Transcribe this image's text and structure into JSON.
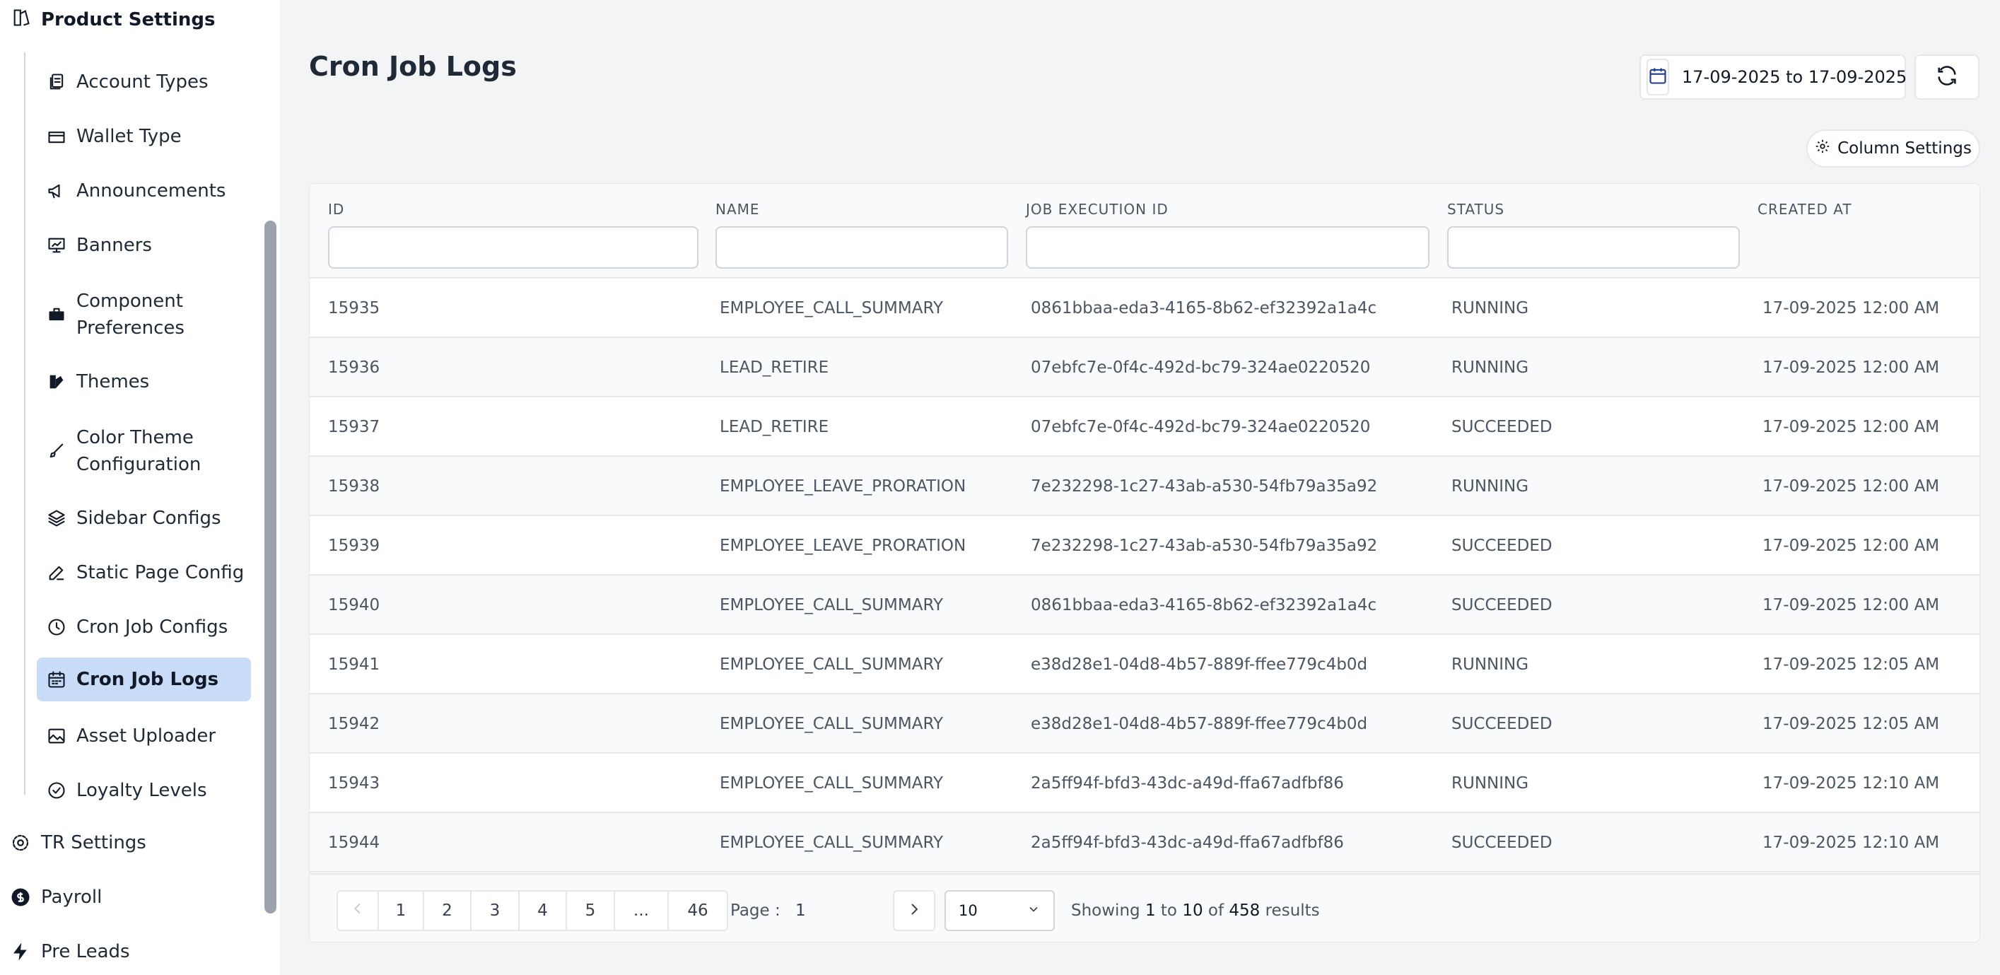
{
  "sidebar": {
    "section_title": "Product Settings",
    "items": [
      {
        "label": "Account Types",
        "icon": "document-copy-icon"
      },
      {
        "label": "Wallet Type",
        "icon": "wallet-icon"
      },
      {
        "label": "Announcements",
        "icon": "megaphone-icon"
      },
      {
        "label": "Banners",
        "icon": "presentation-chart-icon"
      },
      {
        "label": "Component Preferences",
        "icon": "briefcase-icon"
      },
      {
        "label": "Themes",
        "icon": "swatch-icon"
      },
      {
        "label": "Color Theme Configuration",
        "icon": "paintbrush-icon"
      },
      {
        "label": "Sidebar Configs",
        "icon": "layers-icon"
      },
      {
        "label": "Static Page Config",
        "icon": "edit-icon"
      },
      {
        "label": "Cron Job Configs",
        "icon": "clock-icon"
      },
      {
        "label": "Cron Job Logs",
        "icon": "calendar-log-icon",
        "active": true
      },
      {
        "label": "Asset Uploader",
        "icon": "image-icon"
      },
      {
        "label": "Loyalty Levels",
        "icon": "check-circle-icon"
      }
    ],
    "top_items": [
      {
        "label": "TR Settings",
        "icon": "gear-icon"
      },
      {
        "label": "Payroll",
        "icon": "dollar-circle-icon"
      },
      {
        "label": "Pre Leads",
        "icon": "lightning-icon"
      }
    ]
  },
  "header": {
    "title": "Cron Job Logs",
    "date_range": "17-09-2025 to 17-09-2025",
    "column_settings_label": "Column Settings"
  },
  "table": {
    "columns": [
      "ID",
      "NAME",
      "JOB EXECUTION ID",
      "STATUS",
      "CREATED AT"
    ],
    "rows": [
      [
        "15935",
        "EMPLOYEE_CALL_SUMMARY",
        "0861bbaa-eda3-4165-8b62-ef32392a1a4c",
        "RUNNING",
        "17-09-2025 12:00 AM"
      ],
      [
        "15936",
        "LEAD_RETIRE",
        "07ebfc7e-0f4c-492d-bc79-324ae0220520",
        "RUNNING",
        "17-09-2025 12:00 AM"
      ],
      [
        "15937",
        "LEAD_RETIRE",
        "07ebfc7e-0f4c-492d-bc79-324ae0220520",
        "SUCCEEDED",
        "17-09-2025 12:00 AM"
      ],
      [
        "15938",
        "EMPLOYEE_LEAVE_PRORATION",
        "7e232298-1c27-43ab-a530-54fb79a35a92",
        "RUNNING",
        "17-09-2025 12:00 AM"
      ],
      [
        "15939",
        "EMPLOYEE_LEAVE_PRORATION",
        "7e232298-1c27-43ab-a530-54fb79a35a92",
        "SUCCEEDED",
        "17-09-2025 12:00 AM"
      ],
      [
        "15940",
        "EMPLOYEE_CALL_SUMMARY",
        "0861bbaa-eda3-4165-8b62-ef32392a1a4c",
        "SUCCEEDED",
        "17-09-2025 12:00 AM"
      ],
      [
        "15941",
        "EMPLOYEE_CALL_SUMMARY",
        "e38d28e1-04d8-4b57-889f-ffee779c4b0d",
        "RUNNING",
        "17-09-2025 12:05 AM"
      ],
      [
        "15942",
        "EMPLOYEE_CALL_SUMMARY",
        "e38d28e1-04d8-4b57-889f-ffee779c4b0d",
        "SUCCEEDED",
        "17-09-2025 12:05 AM"
      ],
      [
        "15943",
        "EMPLOYEE_CALL_SUMMARY",
        "2a5ff94f-bfd3-43dc-a49d-ffa67adfbf86",
        "RUNNING",
        "17-09-2025 12:10 AM"
      ],
      [
        "15944",
        "EMPLOYEE_CALL_SUMMARY",
        "2a5ff94f-bfd3-43dc-a49d-ffa67adfbf86",
        "SUCCEEDED",
        "17-09-2025 12:10 AM"
      ]
    ]
  },
  "pagination": {
    "pages": [
      "1",
      "2",
      "3",
      "4",
      "5",
      "...",
      "46"
    ],
    "page_label": "Page :",
    "current_page": "1",
    "page_size": "10",
    "showing_prefix": "Showing",
    "range_from": "1",
    "to_word": "to",
    "range_to": "10",
    "of_word": "of",
    "total": "458",
    "results_word": "results"
  },
  "colors": {
    "active_bg": "#c8dcf7",
    "page_bg": "#f3f4f6"
  }
}
